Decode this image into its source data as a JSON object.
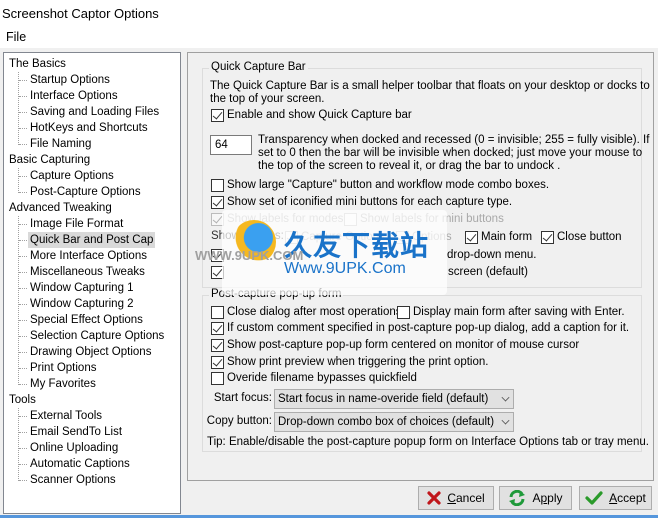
{
  "window": {
    "title": "Screenshot Captor Options"
  },
  "menu": {
    "file": "File"
  },
  "tree": {
    "groups": [
      {
        "label": "The Basics",
        "children": [
          "Startup Options",
          "Interface Options",
          "Saving and Loading Files",
          "HotKeys and Shortcuts",
          "File Naming"
        ]
      },
      {
        "label": "Basic Capturing",
        "children": [
          "Capture Options",
          "Post-Capture Options"
        ]
      },
      {
        "label": "Advanced Tweaking",
        "children": [
          "Image File Format",
          "Quick Bar and Post Cap",
          "More Interface Options",
          "Miscellaneous Tweaks",
          "Window Capturing 1",
          "Window Capturing 2",
          "Special Effect Options",
          "Selection Capture Options",
          "Drawing Object Options",
          "Print Options",
          "My Favorites"
        ]
      },
      {
        "label": "Tools",
        "children": [
          "External Tools",
          "Email SendTo List",
          "Online Uploading",
          "Automatic Captions",
          "Scanner Options"
        ]
      }
    ],
    "selected": "Quick Bar and Post Cap"
  },
  "quick_capture_bar": {
    "legend": "Quick Capture Bar",
    "description_line1": "The Quick Capture Bar is a small helper toolbar that floats on your desktop or docks to",
    "description_line2": "the top of your screen.",
    "enable": {
      "label": "Enable and show Quick Capture bar",
      "checked": true
    },
    "transparency_value": "64",
    "transparency_line1": "Transparency when docked and recessed (0 = invisible; 255 = fully visible). If",
    "transparency_line2": "set to 0 then the bar will be invisible when docked; just move your mouse to",
    "transparency_line3": "the top of the screen to reveal it, or drag the bar to undock .",
    "large_capture": {
      "label": "Show large \"Capture\" button and workflow mode combo boxes.",
      "checked": false
    },
    "iconified": {
      "label": "Show set of iconified mini buttons for each capture type.",
      "checked": true
    },
    "labels_modes": {
      "label": "Show labels for modes",
      "checked": true,
      "disabled": true
    },
    "labels_mini": {
      "label": "Show labels for mini buttons",
      "checked": false,
      "disabled": true
    },
    "show_buttons_label": "Show buttons:",
    "btn_capture_options": {
      "label": "Capture Options",
      "checked": true,
      "disabled": true
    },
    "btn_options": {
      "label": "Options",
      "checked": true,
      "disabled": true
    },
    "btn_main_form": {
      "label": "Main form",
      "checked": true
    },
    "btn_close": {
      "label": "Close button",
      "checked": true
    },
    "dropdown_menu": {
      "label": "... in \"choices\" or settings drop-down menu.",
      "visible_tail": "drop-down menu.",
      "checked": true
    },
    "allow_dock": {
      "label": "Allow Quick Capture Bar to dock to edge of screen (default)",
      "visible_tail": "screen (default)",
      "checked": true
    }
  },
  "post_capture": {
    "legend": "Post-capture pop-up form",
    "close_dialog": {
      "label": "Close dialog after most operations.",
      "checked": false
    },
    "display_main": {
      "label": "Display main form after saving with Enter.",
      "checked": false
    },
    "custom_comment": {
      "label": "If custom comment specified in post-capture pop-up dialog, add a caption for it.",
      "checked": true
    },
    "centered": {
      "label": "Show post-capture pop-up form centered on monitor of mouse cursor",
      "checked": true
    },
    "print_preview": {
      "label": "Show print preview when triggering the print option.",
      "checked": true
    },
    "override": {
      "label": "Overide filename bypasses quickfield",
      "checked": false
    },
    "start_focus_label": "Start focus:",
    "start_focus_value": "Start focus in name-overide field (default)",
    "copy_button_label": "Copy button:",
    "copy_button_value": "Drop-down combo box of choices (default)",
    "tip": "Tip: Enable/disable the post-capture popup form on Interface Options tab or tray menu."
  },
  "buttons": {
    "cancel": {
      "accel": "C",
      "rest": "ancel"
    },
    "apply": {
      "pre": "A",
      "accel": "p",
      "rest": "ply"
    },
    "accept": {
      "accel": "A",
      "rest": "ccept"
    }
  },
  "watermark": {
    "cn": "久友下载站",
    "en": "Www.9UPK.Com",
    "side": "WWW.9UPK.COM"
  },
  "colors": {
    "cancel_icon": "#c0161b",
    "apply_icon": "#1f9a3a",
    "accept_icon": "#2a9a2a",
    "selection": "#d9d9d9"
  }
}
